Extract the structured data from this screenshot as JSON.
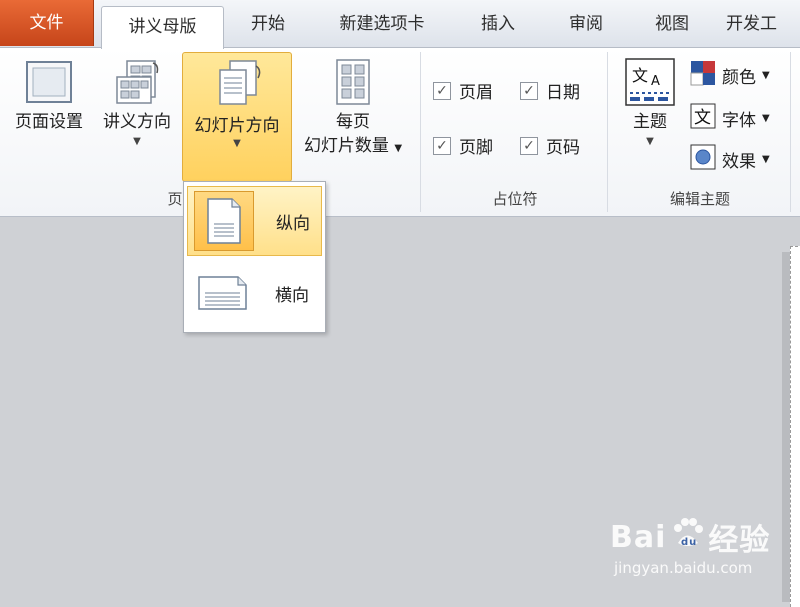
{
  "tabs": {
    "file": "文件",
    "active": "讲义母版",
    "items": [
      "开始",
      "新建选项卡",
      "插入",
      "审阅",
      "视图",
      "开发工"
    ]
  },
  "ribbon": {
    "page_setup": "页面设置",
    "handout_orientation": "讲义方向",
    "slide_orientation": "幻灯片方向",
    "per_page_line1": "每页",
    "per_page_line2": "幻灯片数量",
    "group_page_partial": "页",
    "checks": {
      "header": "页眉",
      "date": "日期",
      "footer": "页脚",
      "page_number": "页码"
    },
    "group_placeholders": "占位符",
    "theme": "主题",
    "colors": "颜色",
    "fonts": "字体",
    "effects": "效果",
    "group_edit_theme": "编辑主题"
  },
  "dropdown": {
    "portrait": "纵向",
    "landscape": "横向"
  },
  "watermark": {
    "main": "Bai",
    "main2": "经验",
    "sub": "jingyan.baidu.com"
  },
  "colors": {
    "file_tab": "#d5552a",
    "highlight": "#ffd46a"
  }
}
